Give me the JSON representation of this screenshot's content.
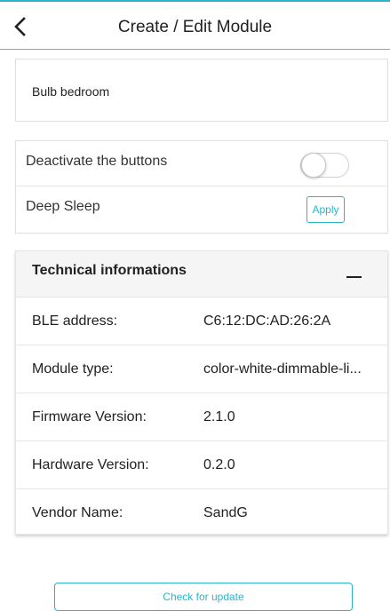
{
  "header": {
    "title": "Create / Edit Module",
    "back_icon": "chevron-left-icon"
  },
  "module": {
    "name": "Bulb bedroom"
  },
  "options": {
    "deactivate_label": "Deactivate the buttons",
    "deactivate_on": false,
    "deep_sleep_label": "Deep Sleep",
    "apply_label": "Apply"
  },
  "tech": {
    "title": "Technical informations",
    "collapse_icon": "minus-icon",
    "rows": [
      {
        "label": "BLE address:",
        "value": "C6:12:DC:AD:26:2A"
      },
      {
        "label": "Module type:",
        "value": "color-white-dimmable-li..."
      },
      {
        "label": "Firmware Version:",
        "value": "2.1.0"
      },
      {
        "label": "Hardware Version:",
        "value": "0.2.0"
      },
      {
        "label": "Vendor Name:",
        "value": "SandG"
      }
    ]
  },
  "footer": {
    "update_label": "Check for update"
  },
  "colors": {
    "accent": "#29b6c8",
    "text": "#212121",
    "header_bg": "#f5f5f5"
  }
}
